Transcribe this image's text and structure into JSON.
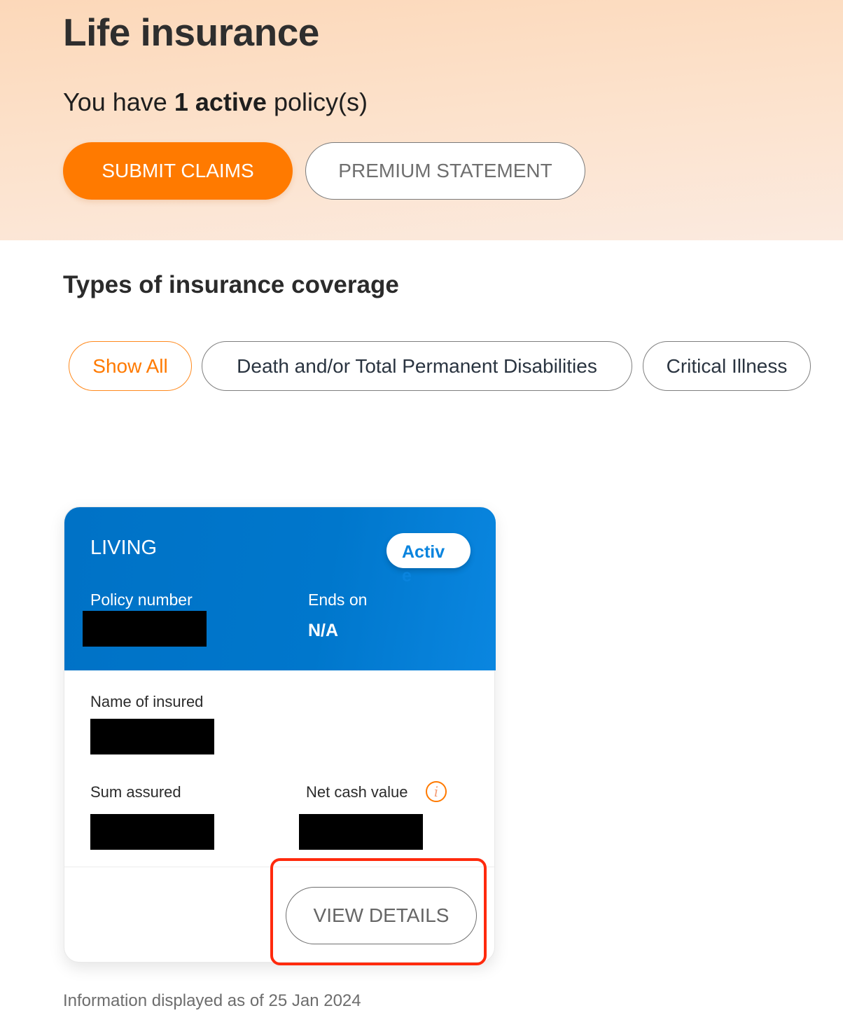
{
  "header": {
    "title": "Life insurance",
    "summary_prefix": "You have ",
    "summary_count": "1",
    "summary_status": "active",
    "summary_suffix": " policy(s)"
  },
  "actions": {
    "submit_claims": "SUBMIT CLAIMS",
    "premium_statement": "PREMIUM STATEMENT"
  },
  "coverage": {
    "title": "Types of insurance coverage",
    "filters": [
      {
        "label": "Show All",
        "selected": true
      },
      {
        "label": "Death and/or Total Permanent Disabilities",
        "selected": false
      },
      {
        "label": "Critical Illness",
        "selected": false
      }
    ]
  },
  "policy_card": {
    "plan_name": "LIVING",
    "status": "Active",
    "policy_number_label": "Policy number",
    "policy_number_value": "[redacted]",
    "ends_on_label": "Ends on",
    "ends_on_value": "N/A",
    "insured_label": "Name of insured",
    "insured_value": "[redacted]",
    "sum_assured_label": "Sum assured",
    "sum_assured_value": "[redacted]",
    "net_cash_value_label": "Net cash value",
    "net_cash_value_value": "[redacted]",
    "info_icon": "info-icon",
    "info_glyph": "i",
    "view_details": "VIEW DETAILS"
  },
  "footer": {
    "as_of": "Information displayed as of 25 Jan 2024"
  },
  "colors": {
    "accent_orange": "#ff7a00",
    "card_blue": "#0077cc",
    "highlight_red": "#ff2a0d"
  }
}
